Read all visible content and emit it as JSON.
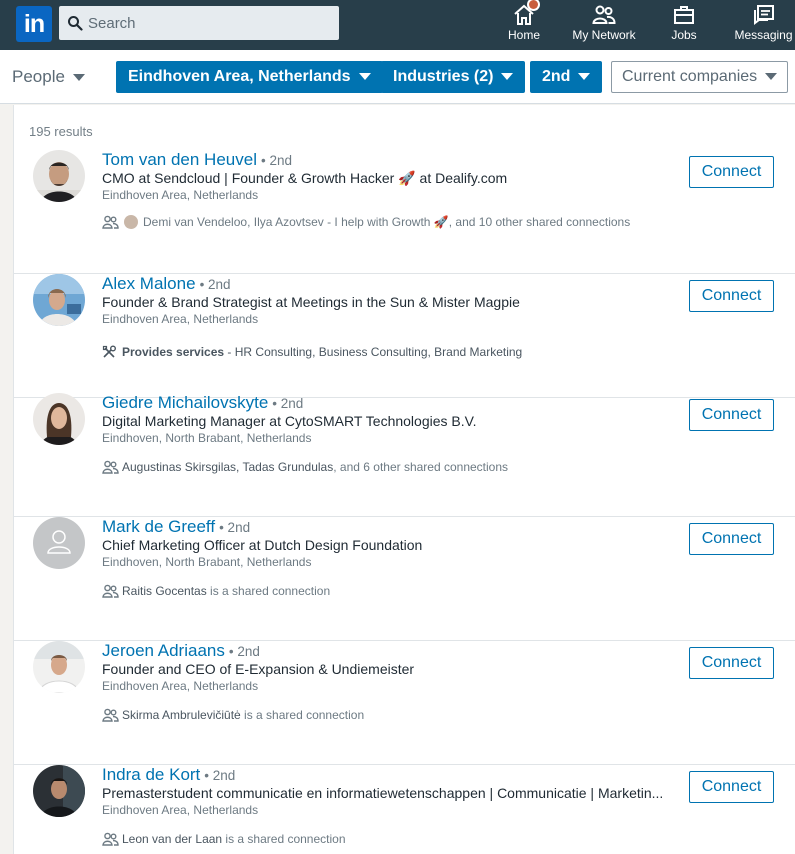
{
  "nav": {
    "logo": "in",
    "search_placeholder": "Search",
    "items": [
      {
        "label": "Home",
        "icon": "home-icon"
      },
      {
        "label": "My Network",
        "icon": "network-icon"
      },
      {
        "label": "Jobs",
        "icon": "briefcase-icon"
      },
      {
        "label": "Messaging",
        "icon": "message-icon"
      }
    ],
    "colors": {
      "bar": "#283e4a",
      "brand": "#0a66c2",
      "badge": "#c95e3d"
    }
  },
  "filters": {
    "people": "People",
    "location": "Eindhoven Area, Netherlands",
    "industries": "Industries (2)",
    "degree": "2nd",
    "companies": "Current companies",
    "accent": "#0073b1"
  },
  "results_count": "195 results",
  "results": [
    {
      "name": "Tom van den Heuvel",
      "degree": "• 2nd",
      "headline": "CMO at Sendcloud | Founder & Growth Hacker 🚀 at Dealify.com",
      "location": "Eindhoven Area, Netherlands",
      "shared": "Demi van Vendeloo, Ilya Azovtsev - I help with Growth 🚀, and 10 other shared connections",
      "connect": "Connect"
    },
    {
      "name": "Alex Malone",
      "degree": "• 2nd",
      "headline": "Founder & Brand Strategist at Meetings in the Sun & Mister Magpie",
      "location": "Eindhoven Area, Netherlands",
      "services_label": "Provides services",
      "services": " - HR Consulting, Business Consulting, Brand Marketing",
      "connect": "Connect"
    },
    {
      "name": "Giedre Michailovskyte",
      "degree": "• 2nd",
      "headline": "Digital Marketing Manager at CytoSMART Technologies B.V.",
      "location": "Eindhoven, North Brabant, Netherlands",
      "shared_name": "Augustinas Skirsgilas, Tadas Grundulas",
      "shared_rest": ", and 6 other shared connections",
      "connect": "Connect"
    },
    {
      "name": "Mark de Greeff",
      "degree": "• 2nd",
      "headline": "Chief Marketing Officer at Dutch Design Foundation",
      "location": "Eindhoven, North Brabant, Netherlands",
      "shared_name": "Raitis Gocentas",
      "shared_rest": " is a shared connection",
      "connect": "Connect"
    },
    {
      "name": "Jeroen Adriaans",
      "degree": "• 2nd",
      "headline": "Founder and CEO of E-Expansion & Undiemeister",
      "location": "Eindhoven Area, Netherlands",
      "shared_name": "Skirma Ambrulevičiūtė",
      "shared_rest": " is a shared connection",
      "connect": "Connect"
    },
    {
      "name": "Indra de Kort",
      "degree": "• 2nd",
      "headline": "Premasterstudent communicatie en informatiewetenschappen | Communicatie | Marketin...",
      "location": "Eindhoven Area, Netherlands",
      "shared_name": "Leon van der Laan",
      "shared_rest": " is a shared connection",
      "connect": "Connect"
    }
  ]
}
